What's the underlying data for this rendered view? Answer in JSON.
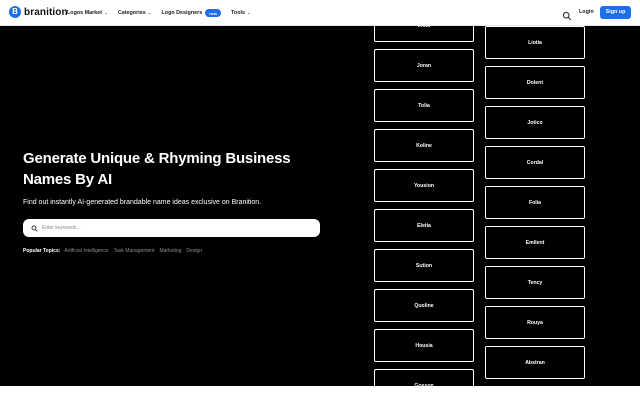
{
  "header": {
    "logo_letter": "B",
    "logo_text": "branition",
    "nav": [
      {
        "label": "Logos Market",
        "chevron": true
      },
      {
        "label": "Categories",
        "chevron": true
      },
      {
        "label": "Logo Designers",
        "badge": "new"
      },
      {
        "label": "Tools",
        "chevron": true
      }
    ],
    "login_label": "Login",
    "signup_label": "Sign up",
    "search_icon": "search-icon"
  },
  "hero": {
    "title": "Generate Unique & Rhyming Business Names By AI",
    "subtitle": "Find out instantly AI-generated brandable name ideas exclusive on Branition.",
    "search_placeholder": "Enter keywords...",
    "topics_label": "Popular Topics:",
    "topics": [
      "Artificial Intelligence",
      "Task Management",
      "Marketing",
      "Design"
    ]
  },
  "names": {
    "column_left": [
      "Inoto",
      "Joran",
      "Tolia",
      "Koline",
      "Yousion",
      "Eletia",
      "Sution",
      "Quoline",
      "Housia",
      "Gosson"
    ],
    "column_right": [
      "Liotia",
      "Dolent",
      "Jotico",
      "Cordal",
      "Folia",
      "Emilent",
      "Tency",
      "Rouya",
      "Abstran"
    ]
  },
  "colors": {
    "brand": "#1d6fe8",
    "hero_bg": "#000000",
    "card_border": "#ffffff"
  }
}
